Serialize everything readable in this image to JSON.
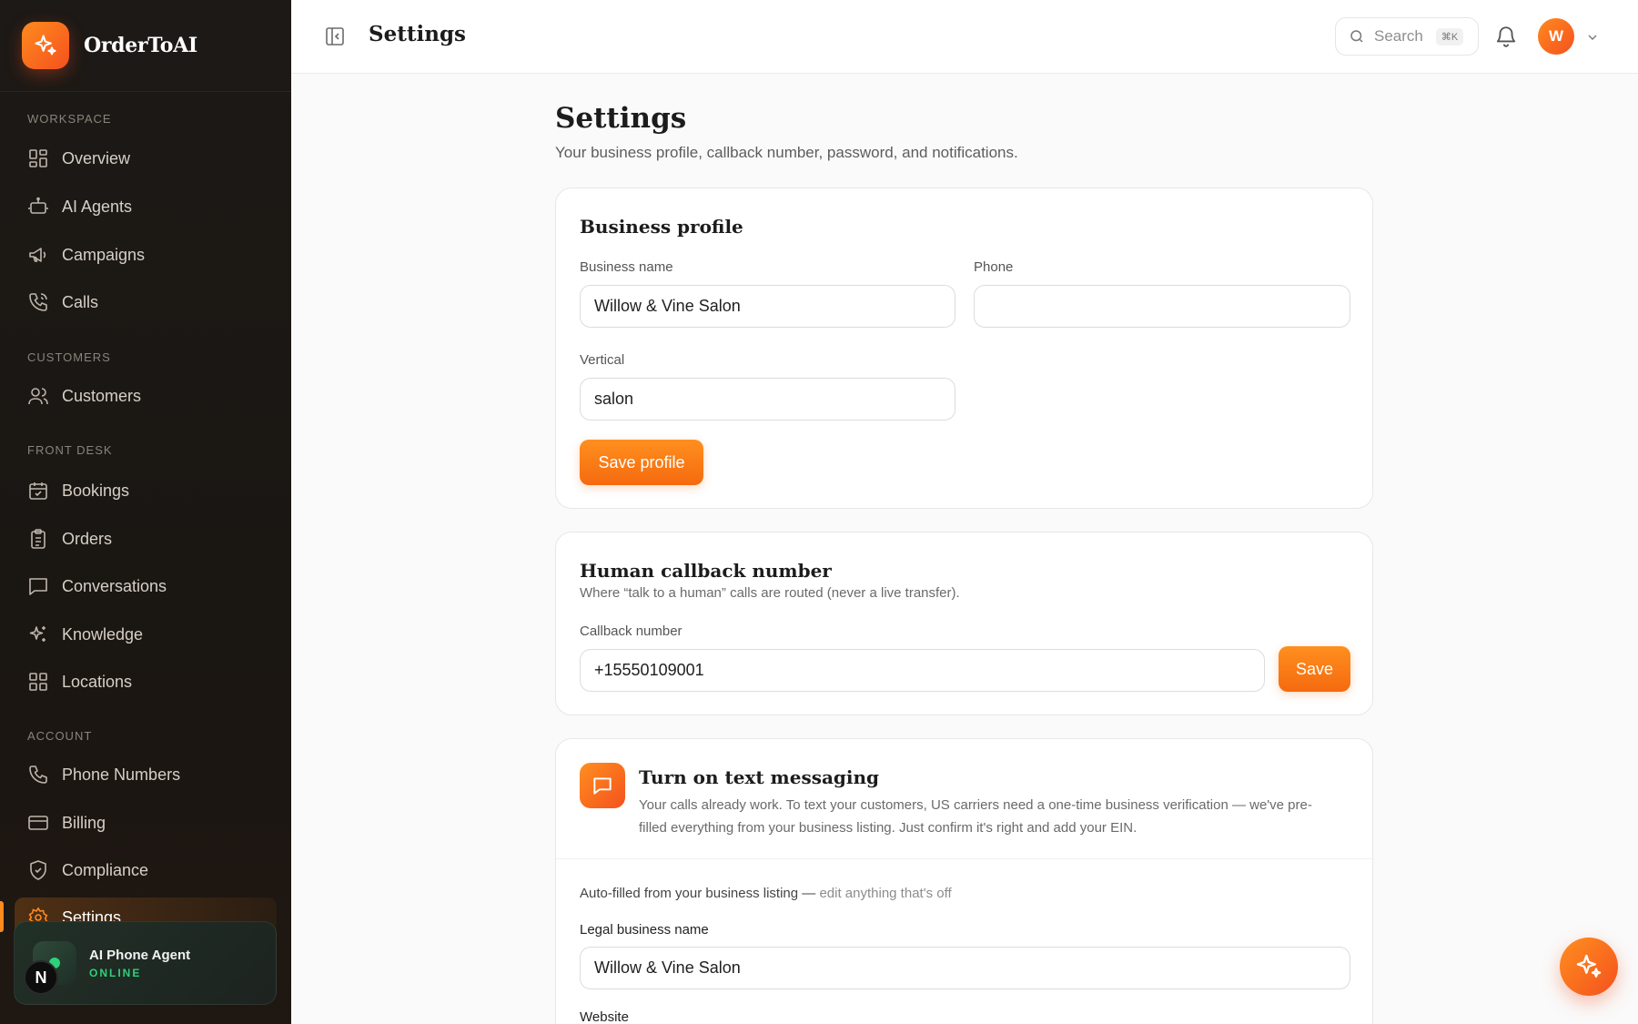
{
  "app": {
    "name": "OrderToAI"
  },
  "sidebar": {
    "sections": {
      "workspace": "WORKSPACE",
      "customers": "CUSTOMERS",
      "front_desk": "FRONT DESK",
      "account": "ACCOUNT"
    },
    "items": {
      "overview": "Overview",
      "ai_agents": "AI Agents",
      "campaigns": "Campaigns",
      "calls": "Calls",
      "customers": "Customers",
      "bookings": "Bookings",
      "orders": "Orders",
      "conversations": "Conversations",
      "knowledge": "Knowledge",
      "locations": "Locations",
      "phone_numbers": "Phone Numbers",
      "billing": "Billing",
      "compliance": "Compliance",
      "settings": "Settings"
    },
    "active_item": "settings",
    "agent_card": {
      "title": "AI Phone Agent",
      "status": "ONLINE",
      "badge": "N"
    }
  },
  "topbar": {
    "title": "Settings",
    "search_placeholder": "Search",
    "search_shortcut": "⌘K",
    "user_initial": "W"
  },
  "page": {
    "title": "Settings",
    "subtitle": "Your business profile, callback number, password, and notifications."
  },
  "business_profile": {
    "title": "Business profile",
    "business_name_label": "Business name",
    "business_name_value": "Willow & Vine Salon",
    "phone_label": "Phone",
    "phone_value": "",
    "vertical_label": "Vertical",
    "vertical_value": "salon",
    "save_label": "Save profile"
  },
  "callback": {
    "title": "Human callback number",
    "description": "Where “talk to a human” calls are routed (never a live transfer).",
    "label": "Callback number",
    "value": "+15550109001",
    "save_label": "Save"
  },
  "text_messaging": {
    "title": "Turn on text messaging",
    "description_line1": "Your calls already work. To text your customers, US carriers need a one-time business verification — we've pre-",
    "description_line2": "filled everything from your business listing. Just confirm it's right and add your EIN.",
    "autofill_note": "Auto-filled from your business listing —",
    "autofill_note_muted": "edit anything that's off",
    "legal_name_label": "Legal business name",
    "legal_name_value": "Willow & Vine Salon",
    "website_label": "Website"
  },
  "colors": {
    "accent": "#ff8a1e",
    "accent_dark": "#f4511e",
    "sidebar_bg": "#1d1916",
    "online": "#2fd07a"
  },
  "icons": {
    "brand": "sparkle-icon",
    "fab": "sparkle-icon"
  }
}
